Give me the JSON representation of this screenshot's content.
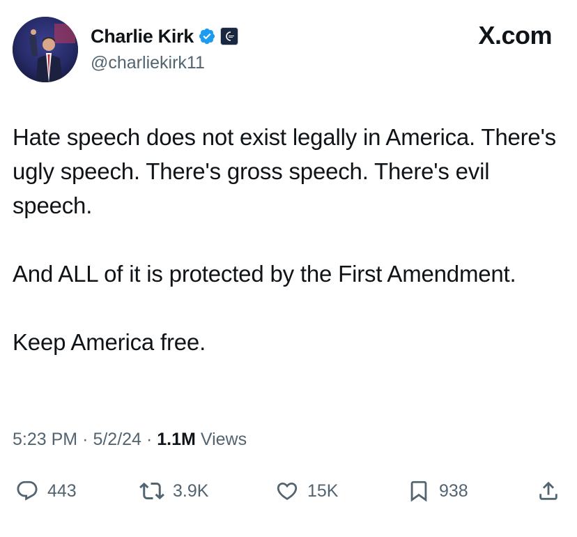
{
  "header": {
    "display_name": "Charlie Kirk",
    "handle": "@charliekirk11",
    "brand": "X.com",
    "verified_icon": "verified-badge-icon",
    "affiliate_icon": "affiliate-badge-icon",
    "verified_color": "#1d9bf0"
  },
  "tweet": {
    "paragraphs": [
      "Hate speech does not exist legally in America. There's ugly speech. There's gross speech. There's evil speech.",
      "And ALL of it is protected by the First Amendment.",
      "Keep America free."
    ]
  },
  "meta": {
    "time": "5:23 PM",
    "date": "5/2/24",
    "views_count": "1.1M",
    "views_label": "Views"
  },
  "actions": {
    "replies": "443",
    "reposts": "3.9K",
    "likes": "15K",
    "bookmarks": "938"
  }
}
